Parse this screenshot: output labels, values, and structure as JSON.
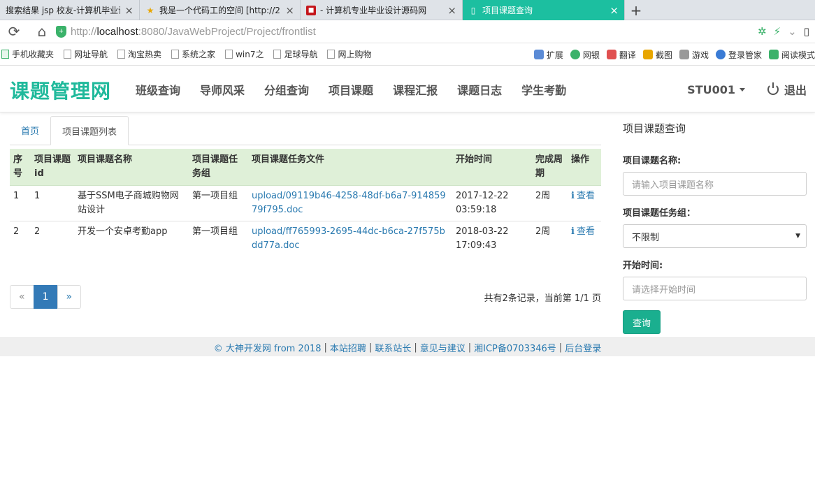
{
  "browser": {
    "tabs": [
      {
        "title": "搜索结果 jsp 校友-计算机毕业设",
        "icon": "search-page-icon",
        "active": false
      },
      {
        "title": "我是一个代码工的空间 [http://2",
        "icon": "star-icon",
        "active": false
      },
      {
        "title": "- 计算机专业毕业设计源码网",
        "icon": "site-favicon-icon",
        "active": false
      },
      {
        "title": "项目课题查询",
        "icon": "page-icon",
        "active": true
      }
    ],
    "url_prefix": "http://",
    "url_host": "localhost",
    "url_rest": ":8080/JavaWebProject/Project/frontlist",
    "bookmarks": [
      "手机收藏夹",
      "网址导航",
      "淘宝热卖",
      "系统之家",
      "win7之",
      "足球导航",
      "网上购物"
    ],
    "bookmarks_right": [
      "扩展",
      "网银",
      "翻译",
      "截图",
      "游戏",
      "登录管家",
      "阅读模式"
    ]
  },
  "header": {
    "brand": "课题管理网",
    "nav": [
      "班级查询",
      "导师风采",
      "分组查询",
      "项目课题",
      "课程汇报",
      "课题日志",
      "学生考勤"
    ],
    "user": "STU001",
    "logout": "退出"
  },
  "main": {
    "tabs": [
      "首页",
      "项目课题列表"
    ],
    "columns": [
      "序号",
      "项目课题id",
      "项目课题名称",
      "项目课题任务组",
      "项目课题任务文件",
      "开始时间",
      "完成周期",
      "操作"
    ],
    "rows": [
      {
        "seq": "1",
        "id": "1",
        "name": "基于SSM电子商城购物网站设计",
        "group": "第一项目组",
        "file": "upload/09119b46-4258-48df-b6a7-91485979f795.doc",
        "start": "2017-12-22 03:59:18",
        "period": "2周",
        "action": "查看"
      },
      {
        "seq": "2",
        "id": "2",
        "name": "开发一个安卓考勤app",
        "group": "第一项目组",
        "file": "upload/ff765993-2695-44dc-b6ca-27f575bdd77a.doc",
        "start": "2018-03-22 17:09:43",
        "period": "2周",
        "action": "查看"
      }
    ],
    "pagination": {
      "prev": "«",
      "current": "1",
      "next": "»"
    },
    "page_info": "共有2条记录，当前第 1/1 页"
  },
  "sidebar": {
    "title": "项目课题查询",
    "name_label": "项目课题名称:",
    "name_placeholder": "请输入项目课题名称",
    "group_label": "项目课题任务组：",
    "group_value": "不限制",
    "start_label": "开始时间:",
    "start_placeholder": "请选择开始时间",
    "query_button": "查询"
  },
  "footer": {
    "links": [
      "© 大神开发网 from 2018",
      "本站招聘",
      "联系站长",
      "意见与建议",
      "湘ICP备0703346号",
      "后台登录"
    ]
  },
  "colors": {
    "brand": "#1fb99b",
    "active_tab": "#1cbfa0",
    "table_header": "#dff0d8",
    "link": "#2a7ab0",
    "primary_button": "#1aaf8f"
  }
}
